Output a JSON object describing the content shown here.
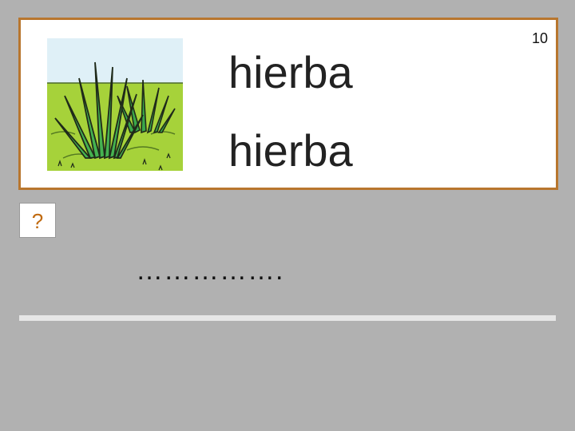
{
  "card": {
    "page_number": "10",
    "word_1": "hierba",
    "word_2": "hierba",
    "image_icon": "grass-illustration",
    "border_color": "#b8762e"
  },
  "prompt": {
    "question_mark": "?",
    "blank_dots": "……………."
  },
  "colors": {
    "background": "#b1b1b1",
    "question_mark": "#c06a10",
    "sky": "#dff0f7",
    "ground": "#a6d23a",
    "grass_dark": "#1f2a1a",
    "grass_green": "#3aa84a"
  }
}
